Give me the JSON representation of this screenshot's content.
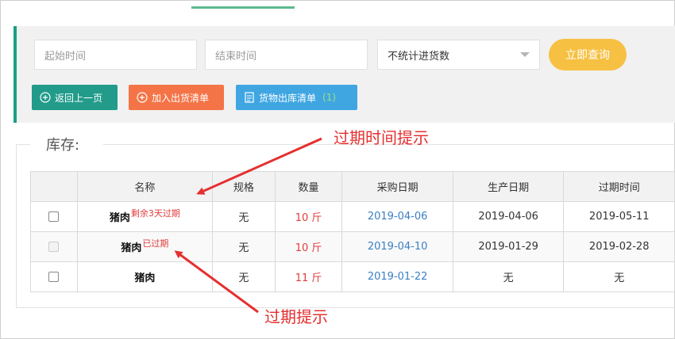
{
  "filters": {
    "start_placeholder": "起始时间",
    "end_placeholder": "结束时间",
    "select_value": "不统计进货数",
    "query_label": "立即查询"
  },
  "actions": {
    "back_label": "返回上一页",
    "add_label": "加入出货清单",
    "list_label": "货物出库清单",
    "list_badge": "(1)"
  },
  "stock": {
    "legend": "库存:",
    "headers": [
      "名称",
      "规格",
      "数量",
      "采购日期",
      "生产日期",
      "过期时间"
    ],
    "rows": [
      {
        "name": "猪肉",
        "hint": "剩余3天过期",
        "spec": "无",
        "qty": "10 斤",
        "purchase": "2019-04-06",
        "produce": "2019-04-06",
        "expire": "2019-05-11",
        "disabled": false
      },
      {
        "name": "猪肉",
        "hint": "已过期",
        "spec": "无",
        "qty": "10 斤",
        "purchase": "2019-04-10",
        "produce": "2019-01-29",
        "expire": "2019-02-28",
        "disabled": true
      },
      {
        "name": "猪肉",
        "hint": "",
        "spec": "无",
        "qty": "11 斤",
        "purchase": "2019-01-22",
        "produce": "无",
        "expire": "无",
        "disabled": false
      }
    ]
  },
  "annotations": {
    "top": "过期时间提示",
    "bottom": "过期提示"
  },
  "colors": {
    "accent": "#1b9e86",
    "query": "#f6c042",
    "back": "#229b8a",
    "add": "#f47447",
    "list": "#3fa6e2",
    "warning": "#e23c3c",
    "link": "#3a7fc4"
  }
}
